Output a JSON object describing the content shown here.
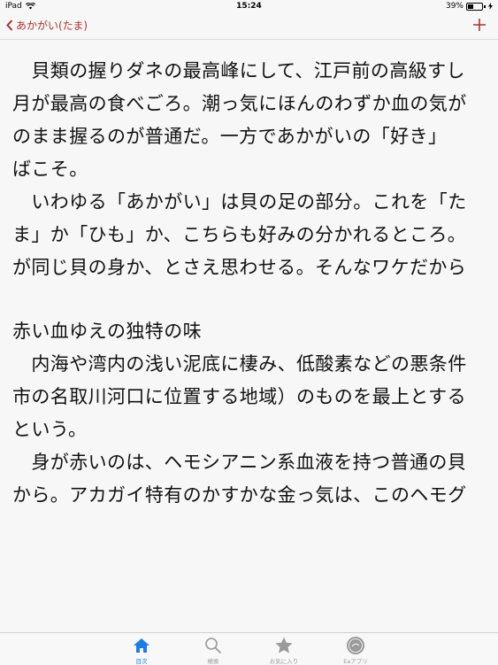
{
  "status_bar": {
    "device": "iPad",
    "time": "15:24",
    "battery_percent": "39%",
    "battery_level": 0.39
  },
  "nav": {
    "back_label": "あかがい(たま)"
  },
  "article": {
    "lines": [
      "　貝類の握りダネの最高峰にして、江戸前の高級すし",
      "月が最高の食べごろ。潮っ気にほんのわずか血の気が",
      "のまま握るのが普通だ。一方であかがいの「好き」",
      "ばこそ。",
      "　いわゆる「あかがい」は貝の足の部分。これを「た",
      "ま」か「ひも」か、こちらも好みの分かれるところ。",
      "が同じ貝の身か、とさえ思わせる。そんなワケだから",
      "",
      "赤い血ゆえの独特の味",
      "　内海や湾内の浅い泥底に棲み、低酸素などの悪条件",
      "市の名取川河口に位置する地域）のものを最上とする",
      "という。",
      "　身が赤いのは、ヘモシアニン系血液を持つ普通の貝",
      "から。アカガイ特有のかすかな金っ気は、このヘモグ"
    ]
  },
  "tabs": [
    {
      "label": "目次",
      "icon": "home-icon",
      "active": true
    },
    {
      "label": "検索",
      "icon": "search-icon",
      "active": false
    },
    {
      "label": "お気に入り",
      "icon": "star-icon",
      "active": false
    },
    {
      "label": "Eaアプリ",
      "icon": "app-logo-icon",
      "active": false
    }
  ],
  "colors": {
    "accent": "#a8342c",
    "tab_active": "#1a7ee6",
    "tab_inactive": "#9a9a9a"
  }
}
